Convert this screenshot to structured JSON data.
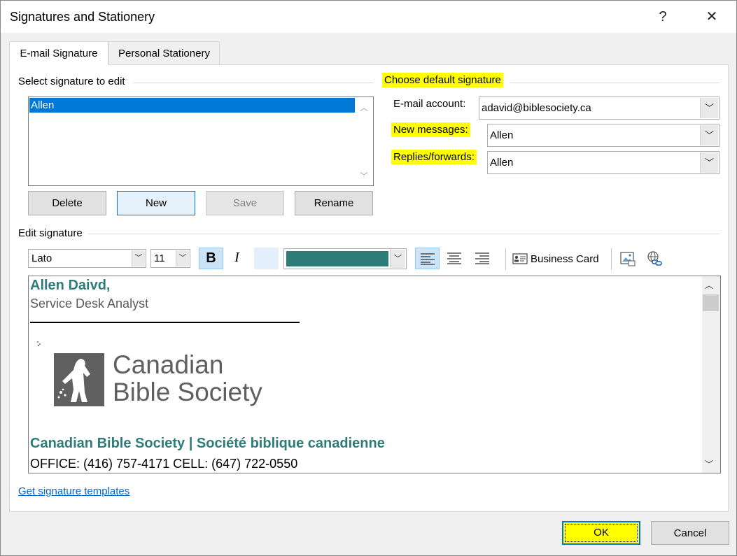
{
  "window": {
    "title": "Signatures and Stationery",
    "help_glyph": "?",
    "close_glyph": "✕"
  },
  "tabs": [
    {
      "label": "E-mail Signature",
      "active": true
    },
    {
      "label": "Personal Stationery",
      "active": false
    }
  ],
  "select_signature": {
    "group_label": "Select signature to edit",
    "items": [
      "Allen"
    ],
    "selected": "Allen"
  },
  "buttons": {
    "delete": "Delete",
    "new": "New",
    "save": "Save",
    "rename": "Rename",
    "ok": "OK",
    "cancel": "Cancel"
  },
  "default_signature": {
    "group_label": "Choose default signature",
    "email_account_label": "E-mail account:",
    "email_account_value": "adavid@biblesociety.ca",
    "new_messages_label": "New messages:",
    "new_messages_value": "Allen",
    "replies_label": "Replies/forwards:",
    "replies_value": "Allen"
  },
  "edit_signature": {
    "group_label": "Edit signature",
    "font": "Lato",
    "size": "11",
    "bold_glyph": "B",
    "italic_glyph": "I",
    "font_color": "#2e7c7a",
    "business_card_label": "Business Card"
  },
  "signature_content": {
    "name": "Allen Daivd,",
    "title": "Service Desk Analyst",
    "logo_line1": "Canadian",
    "logo_line2": "Bible Society",
    "org_line": "Canadian Bible Society | Société biblique canadienne",
    "phone_line": "OFFICE: (416) 757-4171 CELL: (647) 722-0550"
  },
  "footer": {
    "templates_link": "Get signature templates"
  },
  "colors": {
    "highlight": "#ffff00",
    "selection": "#0078d7",
    "brand_teal": "#2e7c7a"
  }
}
